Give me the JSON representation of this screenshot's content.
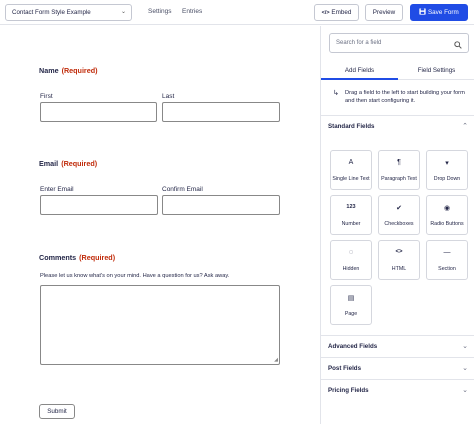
{
  "topbar": {
    "form_name": "Contact Form Style Example",
    "links": [
      "Settings",
      "Entries"
    ],
    "embed_label": "Embed",
    "preview_label": "Preview",
    "save_label": "Save Form"
  },
  "form": {
    "name_label": "Name",
    "required_text": "(Required)",
    "first_label": "First",
    "last_label": "Last",
    "email_label": "Email",
    "enter_email_label": "Enter Email",
    "confirm_email_label": "Confirm Email",
    "comments_label": "Comments",
    "comments_desc": "Please let us know what's on your mind. Have a question for us? Ask away.",
    "submit_label": "Submit"
  },
  "panel": {
    "search_placeholder": "Search for a field",
    "tabs": [
      "Add Fields",
      "Field Settings"
    ],
    "hint": "Drag a field to the left to start building your form and then start configuring it.",
    "standard_fields_label": "Standard Fields",
    "standard_fields": [
      {
        "label": "Single Line Text",
        "icon": "A"
      },
      {
        "label": "Paragraph Text",
        "icon": "¶"
      },
      {
        "label": "Drop Down",
        "icon": "▾"
      },
      {
        "label": "Number",
        "icon": "123"
      },
      {
        "label": "Checkboxes",
        "icon": "✔"
      },
      {
        "label": "Radio Buttons",
        "icon": "◉"
      },
      {
        "label": "Hidden",
        "icon": "◌"
      },
      {
        "label": "HTML",
        "icon": "<>"
      },
      {
        "label": "Section",
        "icon": "—"
      },
      {
        "label": "Page",
        "icon": "▤"
      }
    ],
    "groups": [
      "Advanced Fields",
      "Post Fields",
      "Pricing Fields"
    ]
  },
  "colors": {
    "accent": "#204ce5",
    "required": "#c02b0a"
  }
}
